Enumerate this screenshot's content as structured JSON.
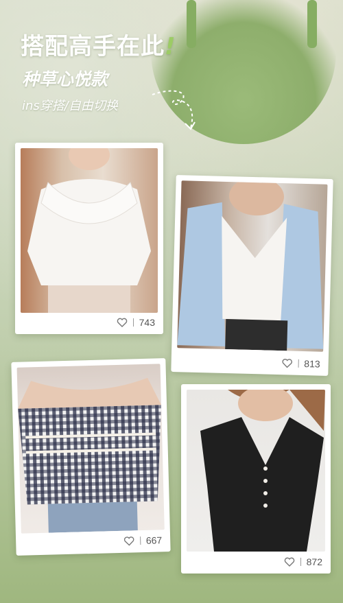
{
  "header": {
    "title": "搭配高手在此",
    "title_mark": "!",
    "subtitle": "种草心悦款",
    "tagline": "ins穿搭/自由切换"
  },
  "cards": [
    {
      "item": "white ruffle collar blouse",
      "likes": "743"
    },
    {
      "item": "white camisole with striped shirt",
      "likes": "813"
    },
    {
      "item": "gingham off-shoulder top",
      "likes": "667"
    },
    {
      "item": "black v-neck knit dress",
      "likes": "872"
    }
  ],
  "colors": {
    "accent_green": "#9ccc65",
    "background": "#c5d2b3",
    "card": "#ffffff"
  },
  "icons": [
    "heart-icon",
    "arrow-down-icon"
  ]
}
